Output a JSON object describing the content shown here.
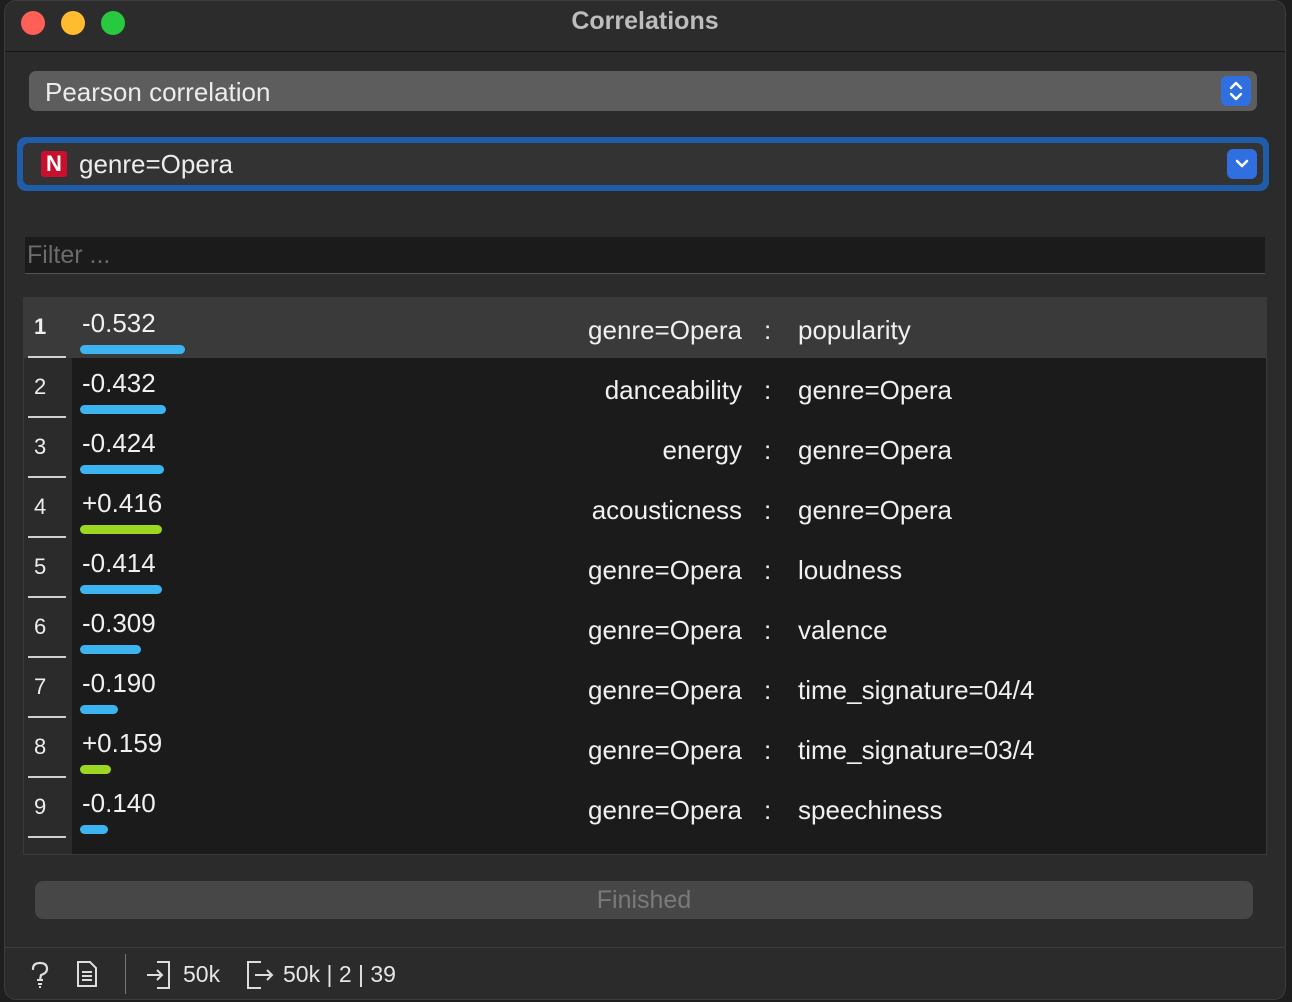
{
  "window": {
    "title": "Correlations"
  },
  "method": {
    "selected": "Pearson correlation"
  },
  "feature": {
    "badge": "N",
    "selected": "genre=Opera"
  },
  "filter": {
    "placeholder": "Filter ..."
  },
  "colors": {
    "negative": "#3bb4f0",
    "positive": "#9ed722",
    "accent": "#2f6fe0",
    "focus_ring": "#1f5da8"
  },
  "table": {
    "rows": [
      {
        "index": "1",
        "value": "-0.532",
        "magnitude": 0.532,
        "sign": "negative",
        "attr1": "genre=Opera",
        "sep": ":",
        "attr2": "popularity"
      },
      {
        "index": "2",
        "value": "-0.432",
        "magnitude": 0.432,
        "sign": "negative",
        "attr1": "danceability",
        "sep": ":",
        "attr2": "genre=Opera"
      },
      {
        "index": "3",
        "value": "-0.424",
        "magnitude": 0.424,
        "sign": "negative",
        "attr1": "energy",
        "sep": ":",
        "attr2": "genre=Opera"
      },
      {
        "index": "4",
        "value": "+0.416",
        "magnitude": 0.416,
        "sign": "positive",
        "attr1": "acousticness",
        "sep": ":",
        "attr2": "genre=Opera"
      },
      {
        "index": "5",
        "value": "-0.414",
        "magnitude": 0.414,
        "sign": "negative",
        "attr1": "genre=Opera",
        "sep": ":",
        "attr2": "loudness"
      },
      {
        "index": "6",
        "value": "-0.309",
        "magnitude": 0.309,
        "sign": "negative",
        "attr1": "genre=Opera",
        "sep": ":",
        "attr2": "valence"
      },
      {
        "index": "7",
        "value": "-0.190",
        "magnitude": 0.19,
        "sign": "negative",
        "attr1": "genre=Opera",
        "sep": ":",
        "attr2": "time_signature=04/4"
      },
      {
        "index": "8",
        "value": "+0.159",
        "magnitude": 0.159,
        "sign": "positive",
        "attr1": "genre=Opera",
        "sep": ":",
        "attr2": "time_signature=03/4"
      },
      {
        "index": "9",
        "value": "-0.140",
        "magnitude": 0.14,
        "sign": "negative",
        "attr1": "genre=Opera",
        "sep": ":",
        "attr2": "speechiness"
      }
    ]
  },
  "progress": {
    "label": "Finished"
  },
  "status": {
    "help_icon": "help-icon",
    "report_icon": "report-icon",
    "input_icon": "input-icon",
    "input_count": "50k",
    "output_icon": "output-icon",
    "output_summary": "50k | 2 | 39"
  }
}
